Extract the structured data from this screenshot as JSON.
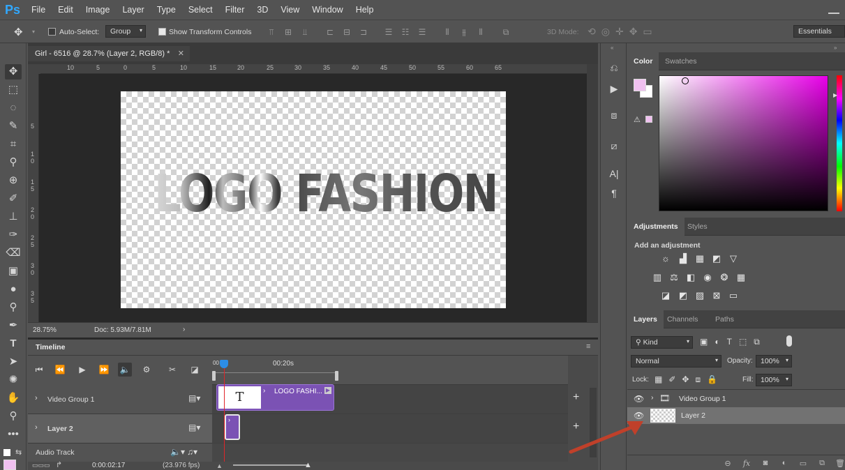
{
  "app": {
    "logo": "Ps"
  },
  "menu": [
    "File",
    "Edit",
    "Image",
    "Layer",
    "Type",
    "Select",
    "Filter",
    "3D",
    "View",
    "Window",
    "Help"
  ],
  "options": {
    "auto_select_label": "Auto-Select:",
    "auto_select_value": "Group",
    "show_transform_label": "Show Transform Controls",
    "mode_3d_label": "3D Mode:",
    "workspace": "Essentials"
  },
  "document": {
    "tab_title": "Girl - 6516 @ 28.7% (Layer 2, RGB/8) *",
    "canvas_text": "LOGO FASHION",
    "zoom": "28.75%",
    "doc_size": "Doc: 5.93M/7.81M",
    "ruler_top": [
      "10",
      "5",
      "0",
      "5",
      "10",
      "15",
      "20",
      "25",
      "30",
      "35",
      "40",
      "45",
      "50",
      "55",
      "60",
      "65"
    ],
    "ruler_left": [
      "5",
      "1",
      "0",
      "1",
      "5",
      "2",
      "0",
      "2",
      "5",
      "3",
      "0",
      "3",
      "5"
    ]
  },
  "timeline": {
    "tab": "Timeline",
    "time_marker": "00:20s",
    "playhead_label": "00",
    "tracks": [
      {
        "name": "Video Group 1"
      },
      {
        "name": "Layer 2"
      },
      {
        "name": "Audio Track"
      }
    ],
    "clip_label": "LOGO FASHI...",
    "clip_thumb": "T",
    "current_time": "0:00:02:17",
    "fps": "(23.976 fps)"
  },
  "color_panel": {
    "tabs": [
      "Color",
      "Swatches"
    ],
    "foreground": "#f0c0f0",
    "background": "#ffffff"
  },
  "adjustments_panel": {
    "tabs": [
      "Adjustments",
      "Styles"
    ],
    "title": "Add an adjustment"
  },
  "layers_panel": {
    "tabs": [
      "Layers",
      "Channels",
      "Paths"
    ],
    "filter": "Kind",
    "blend_mode": "Normal",
    "opacity_label": "Opacity:",
    "opacity": "100%",
    "lock_label": "Lock:",
    "fill_label": "Fill:",
    "fill": "100%",
    "layers": [
      {
        "name": "Video Group 1"
      },
      {
        "name": "Layer 2"
      }
    ]
  },
  "colors": {
    "accent_purple": "#7b52b4",
    "playhead_red": "#e0252a",
    "annotation_arrow": "#c0402a"
  }
}
